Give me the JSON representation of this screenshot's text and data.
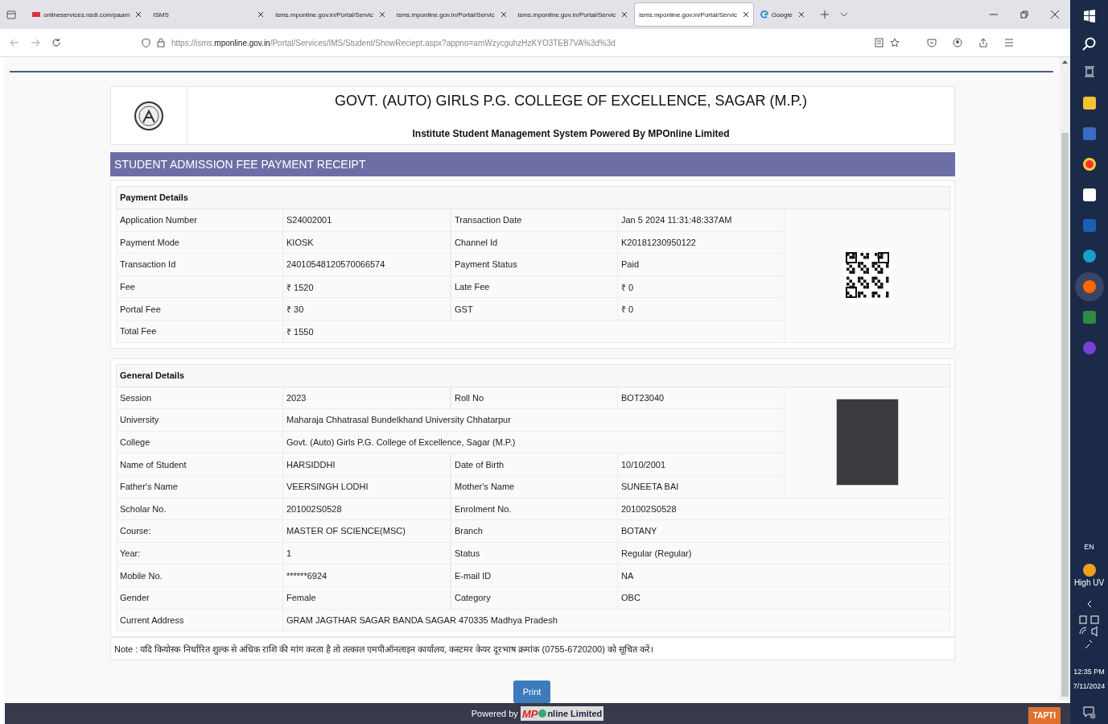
{
  "browser": {
    "tabs": [
      {
        "title": "onlineservices.nsdl.com/paam",
        "selected": false,
        "kind": "nsdl"
      },
      {
        "title": "ISMS",
        "selected": false,
        "kind": "plain"
      },
      {
        "title": "isms.mponline.gov.in/Portal/Servic",
        "selected": false,
        "kind": "plain"
      },
      {
        "title": "isms.mponline.gov.in/Portal/Servic",
        "selected": false,
        "kind": "plain"
      },
      {
        "title": "isms.mponline.gov.in/Portal/Servic",
        "selected": false,
        "kind": "plain"
      },
      {
        "title": "isms.mponline.gov.in/Portal/Servic",
        "selected": true,
        "kind": "plain"
      },
      {
        "title": "Google",
        "selected": false,
        "kind": "google"
      }
    ],
    "url_prefix": "https://isms.",
    "url_domain": "mponline.gov.in",
    "url_rest": "/Portal/Services/IMS/Student/ShowReciept.aspx?appno=amWzycguhzHzKYO3TEB7VA%3d%3d"
  },
  "header": {
    "title": "GOVT. (AUTO) GIRLS P.G. COLLEGE OF EXCELLENCE, SAGAR (M.P.)",
    "subtitle": "Institute Student Management System Powered By MPOnline Limited"
  },
  "receipt_title": "STUDENT ADMISSION FEE PAYMENT RECEIPT",
  "sections": [
    {
      "title": "Payment Details",
      "side": {
        "kind": "qr"
      },
      "side_rows": [
        {
          "cells": [
            "Application Number",
            "S24002001",
            "Transaction Date",
            "Jan 5 2024 11:31:48:337AM"
          ]
        },
        {
          "cells": [
            "Payment Mode",
            "KIOSK",
            "Channel Id",
            "K20181230950122"
          ]
        },
        {
          "cells": [
            "Transaction Id",
            "24010548120570066574",
            "Payment Status",
            "Paid"
          ]
        },
        {
          "cells": [
            "Fee",
            "₹ 1520",
            "Late Fee",
            "₹ 0"
          ]
        },
        {
          "cells": [
            "Portal Fee",
            "₹ 30",
            "GST",
            "₹ 0"
          ]
        },
        {
          "cells": [
            "Total Fee",
            "₹ 1550"
          ]
        }
      ]
    },
    {
      "title": "General Details",
      "side": {
        "kind": "photo"
      },
      "side_rows": [
        {
          "cells": [
            "Session",
            "2023",
            "Roll No",
            "BOT23040"
          ]
        },
        {
          "cells": [
            "University",
            "Maharaja Chhatrasal Bundelkhand University Chhatarpur"
          ]
        },
        {
          "cells": [
            "College",
            "Govt. (Auto) Girls P.G. College of Excellence, Sagar (M.P.)"
          ]
        },
        {
          "cells": [
            "Name of Student",
            "HARSIDDHI",
            "Date of Birth",
            "10/10/2001"
          ]
        },
        {
          "cells": [
            "Father's Name",
            "VEERSINGH LODHI",
            "Mother's Name",
            "SUNEETA BAI"
          ]
        }
      ],
      "rows": [
        {
          "cells": [
            "Scholar No.",
            "201002S0528",
            "Enrolment No.",
            "201002S0528"
          ]
        },
        {
          "cells": [
            "Course:",
            "MASTER OF SCIENCE(MSC)",
            "Branch",
            "BOTANY"
          ]
        },
        {
          "cells": [
            "Year:",
            "1",
            "Status",
            "Regular (Regular)"
          ]
        },
        {
          "cells": [
            "Mobile No.",
            "******6924",
            "E-mail ID",
            "NA"
          ]
        },
        {
          "cells": [
            "Gender",
            "Female",
            "Category",
            "OBC"
          ]
        },
        {
          "cells": [
            "Current Address",
            "GRAM JAGTHAR SAGAR BANDA SAGAR 470335 Madhya Pradesh"
          ]
        }
      ]
    }
  ],
  "note": "Note : यदि कियोस्क निर्धारित शुल्क से अधिक राशि की मांग करता है तो तत्काल एमपीऑनलाइन कार्यालय, कस्टमर केयर दूरभाष क्रमांक (0755-6720200) को सूचित करें।",
  "print_button": "Print",
  "footer": {
    "powered_by": "Powered by",
    "logo_mp": "MP",
    "logo_rest": "nline Limited",
    "tag": "TAPTI"
  },
  "taskbar": {
    "language": "EN",
    "weather": "High UV",
    "time": "12:35 PM",
    "date": "7/11/2024"
  }
}
